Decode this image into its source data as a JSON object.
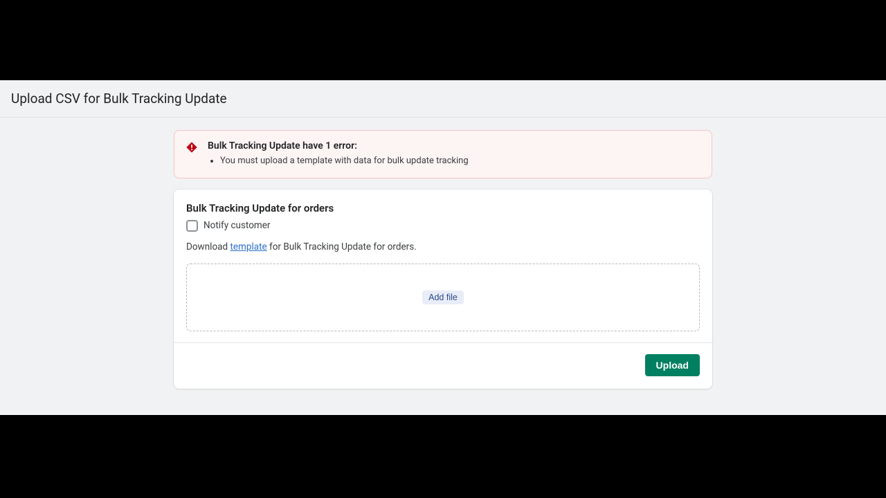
{
  "header": {
    "title": "Upload CSV for Bulk Tracking Update"
  },
  "error_banner": {
    "title": "Bulk Tracking Update have 1 error:",
    "items": [
      "You must upload a template with data for bulk update tracking"
    ]
  },
  "card": {
    "title": "Bulk Tracking Update for orders",
    "notify_checkbox_label": "Notify customer",
    "download_prefix": "Download ",
    "download_link_text": "template",
    "download_suffix": " for Bulk Tracking Update for orders.",
    "add_file_label": "Add file",
    "upload_button_label": "Upload"
  }
}
